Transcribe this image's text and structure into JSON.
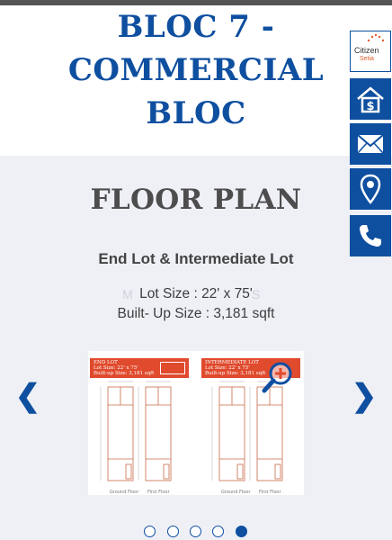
{
  "hero": {
    "title_line1": "BLOC 7 - COMMERCIAL",
    "title_line2": "BLOC"
  },
  "floor_plan": {
    "title": "FLOOR PLAN",
    "subtitle": "End Lot & Intermediate Lot",
    "lot_size": "Lot Size : 22' x 75'",
    "built_up_size": "Built- Up Size : 3,181 sqft",
    "ghost_left": "M",
    "ghost_right": "S"
  },
  "plan_image": {
    "card_a": {
      "title": "END LOT",
      "lot": "Lot Size: 22' x 75'",
      "built": "Built-up Size: 3,181 sqft",
      "cap_left": "Ground Floor",
      "cap_right": "First Floor"
    },
    "card_b": {
      "title": "INTERMEDIATE LOT",
      "lot": "Lot Size: 22' x 75'",
      "built": "Built-up Size: 3,181 sqft",
      "cap_left": "Ground Floor",
      "cap_right": "First Floor"
    }
  },
  "carousel": {
    "prev": "❮",
    "next": "❯",
    "slide_count": 5,
    "active_slide": 5
  },
  "sidebar": {
    "logo_line1": "Citizen",
    "logo_line2": "Setia",
    "buttons": [
      {
        "icon": "house-dollar-icon"
      },
      {
        "icon": "mail-icon"
      },
      {
        "icon": "location-pin-icon"
      },
      {
        "icon": "phone-icon"
      }
    ]
  },
  "colors": {
    "brand_blue": "#0f4fa0",
    "plan_red": "#e04a2d",
    "section_bg": "#eef0f6"
  }
}
